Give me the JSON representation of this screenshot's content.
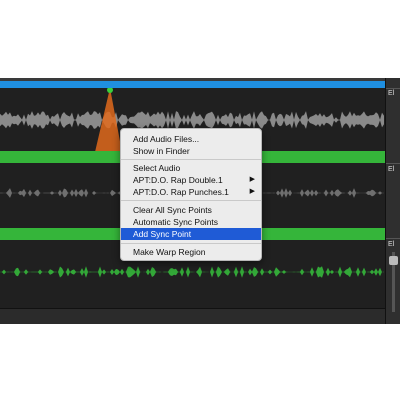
{
  "menu": {
    "items": [
      {
        "label": "Add Audio Files..."
      },
      {
        "label": "Show in Finder"
      },
      {
        "label": "Select Audio"
      },
      {
        "label": "APT:D.O. Rap Double.1",
        "submenu_icon": "chevron-right-icon"
      },
      {
        "label": "APT:D.O. Rap Punches.1",
        "submenu_icon": "chevron-right-icon"
      },
      {
        "label": "Clear All Sync Points"
      },
      {
        "label": "Automatic Sync Points"
      },
      {
        "label": "Add Sync Point",
        "highlighted": true
      },
      {
        "label": "Make Warp Region"
      }
    ]
  },
  "right_panel": {
    "labels": [
      "El",
      "El",
      "El"
    ]
  },
  "colors": {
    "timeline": "#1f8fe0",
    "clip_green": "#35b53a",
    "sync_marker": "#e06a1c",
    "menu_highlight": "#1f5bd6"
  }
}
